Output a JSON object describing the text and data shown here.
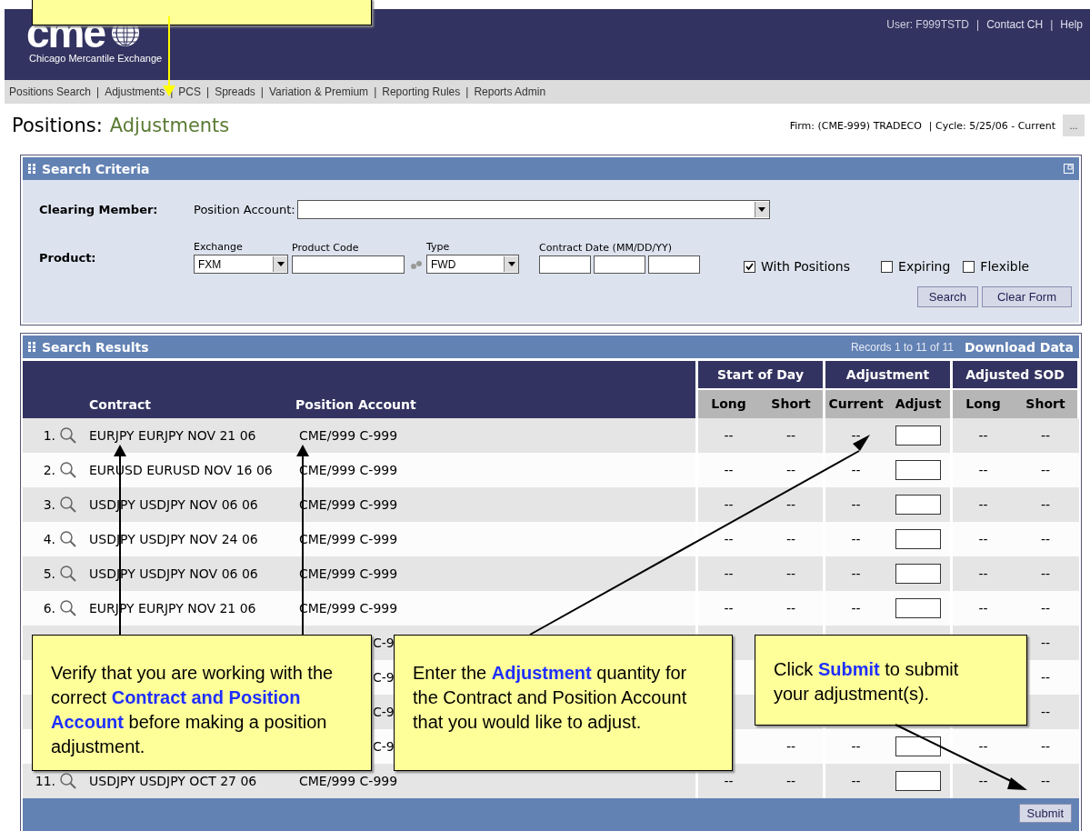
{
  "header": {
    "logo": "cme",
    "logo_subtitle": "Chicago Mercantile Exchange",
    "user_links": [
      "User: F999TSTD",
      "Contact CH",
      "Help"
    ],
    "separator": "|"
  },
  "nav": {
    "items": [
      "Positions Search",
      "Adjustments",
      "PCS",
      "Spreads",
      "Variation & Premium",
      "Reporting Rules",
      "Reports Admin"
    ],
    "separator": "|"
  },
  "page_title": {
    "section": "Positions:",
    "page": "Adjustments"
  },
  "context": {
    "firm": "Firm: (CME-999) TRADECO",
    "cycle": "| Cycle: 5/25/06 - Current",
    "more_button": "..."
  },
  "search_criteria": {
    "title": "Search Criteria",
    "clearing_member_label": "Clearing Member:",
    "position_account_label": "Position Account:",
    "product_label": "Product:",
    "exchange": {
      "label": "Exchange",
      "value": "FXM"
    },
    "product_code": {
      "label": "Product Code"
    },
    "type": {
      "label": "Type",
      "value": "FWD"
    },
    "contract_date": {
      "label": "Contract Date (MM/DD/YY)"
    },
    "checkboxes": [
      {
        "label": "With Positions",
        "checked": true
      },
      {
        "label": "Expiring",
        "checked": false
      },
      {
        "label": "Flexible",
        "checked": false
      }
    ],
    "buttons": [
      "Search",
      "Clear Form"
    ]
  },
  "search_results": {
    "title": "Search Results",
    "records": "Records 1 to 11 of 11",
    "download": "Download Data",
    "columns": {
      "contract": "Contract",
      "account": "Position Account",
      "groups": [
        {
          "title": "Start of Day",
          "sub": [
            "Long",
            "Short"
          ]
        },
        {
          "title": "Adjustment",
          "sub": [
            "Current",
            "Adjust"
          ]
        },
        {
          "title": "Adjusted SOD",
          "sub": [
            "Long",
            "Short"
          ]
        }
      ]
    },
    "rows": [
      {
        "num": "1.",
        "contract": "EURJPY EURJPY NOV 21 06",
        "account": "CME/999 C-999",
        "sod_long": "--",
        "sod_short": "--",
        "current": "--",
        "adjust_field": true,
        "adj_long": "--",
        "adj_short": "--"
      },
      {
        "num": "2.",
        "contract": "EURUSD EURUSD NOV 16 06",
        "account": "CME/999 C-999",
        "sod_long": "--",
        "sod_short": "--",
        "current": "--",
        "adjust_field": true,
        "adj_long": "--",
        "adj_short": "--"
      },
      {
        "num": "3.",
        "contract": "USDJPY USDJPY NOV 06 06",
        "account": "CME/999 C-999",
        "sod_long": "--",
        "sod_short": "--",
        "current": "--",
        "adjust_field": true,
        "adj_long": "--",
        "adj_short": "--"
      },
      {
        "num": "4.",
        "contract": "USDJPY USDJPY NOV 24 06",
        "account": "CME/999 C-999",
        "sod_long": "--",
        "sod_short": "--",
        "current": "--",
        "adjust_field": true,
        "adj_long": "--",
        "adj_short": "--"
      },
      {
        "num": "5.",
        "contract": "USDJPY USDJPY NOV 06 06",
        "account": "CME/999 C-999",
        "sod_long": "--",
        "sod_short": "--",
        "current": "--",
        "adjust_field": true,
        "adj_long": "--",
        "adj_short": "--"
      },
      {
        "num": "6.",
        "contract": "EURJPY EURJPY NOV 21 06",
        "account": "CME/999 C-999",
        "sod_long": "--",
        "sod_short": "--",
        "current": "--",
        "adjust_field": true,
        "adj_long": "--",
        "adj_short": "--"
      },
      {
        "account_fragment": "C-9",
        "adj_short": "--"
      },
      {
        "account_fragment": "C-9",
        "adj_short": "--"
      },
      {
        "account_fragment": "C-9",
        "adj_short": "--"
      },
      {
        "account_fragment": "C-9",
        "sod_short": "--",
        "current": "--",
        "adjust_field": true,
        "adj_long": "--",
        "adj_short": "--"
      },
      {
        "num": "11.",
        "contract": "USDJPY USDJPY OCT 27 06",
        "account": "CME/999 C-999",
        "sod_long": "--",
        "sod_short": "--",
        "current": "--",
        "adjust_field": true,
        "adj_long": "--",
        "adj_short": "--"
      }
    ],
    "submit": "Submit"
  },
  "partial_callout": true,
  "callouts": [
    {
      "text": "Verify that you are working with the correct **Contract and Position Account** before making a position adjustment."
    },
    {
      "text": "Enter the **Adjustment** quantity for the Contract and Position Account that you would like to adjust."
    },
    {
      "text": "Click **Submit** to submit your adjustment(s)."
    }
  ]
}
